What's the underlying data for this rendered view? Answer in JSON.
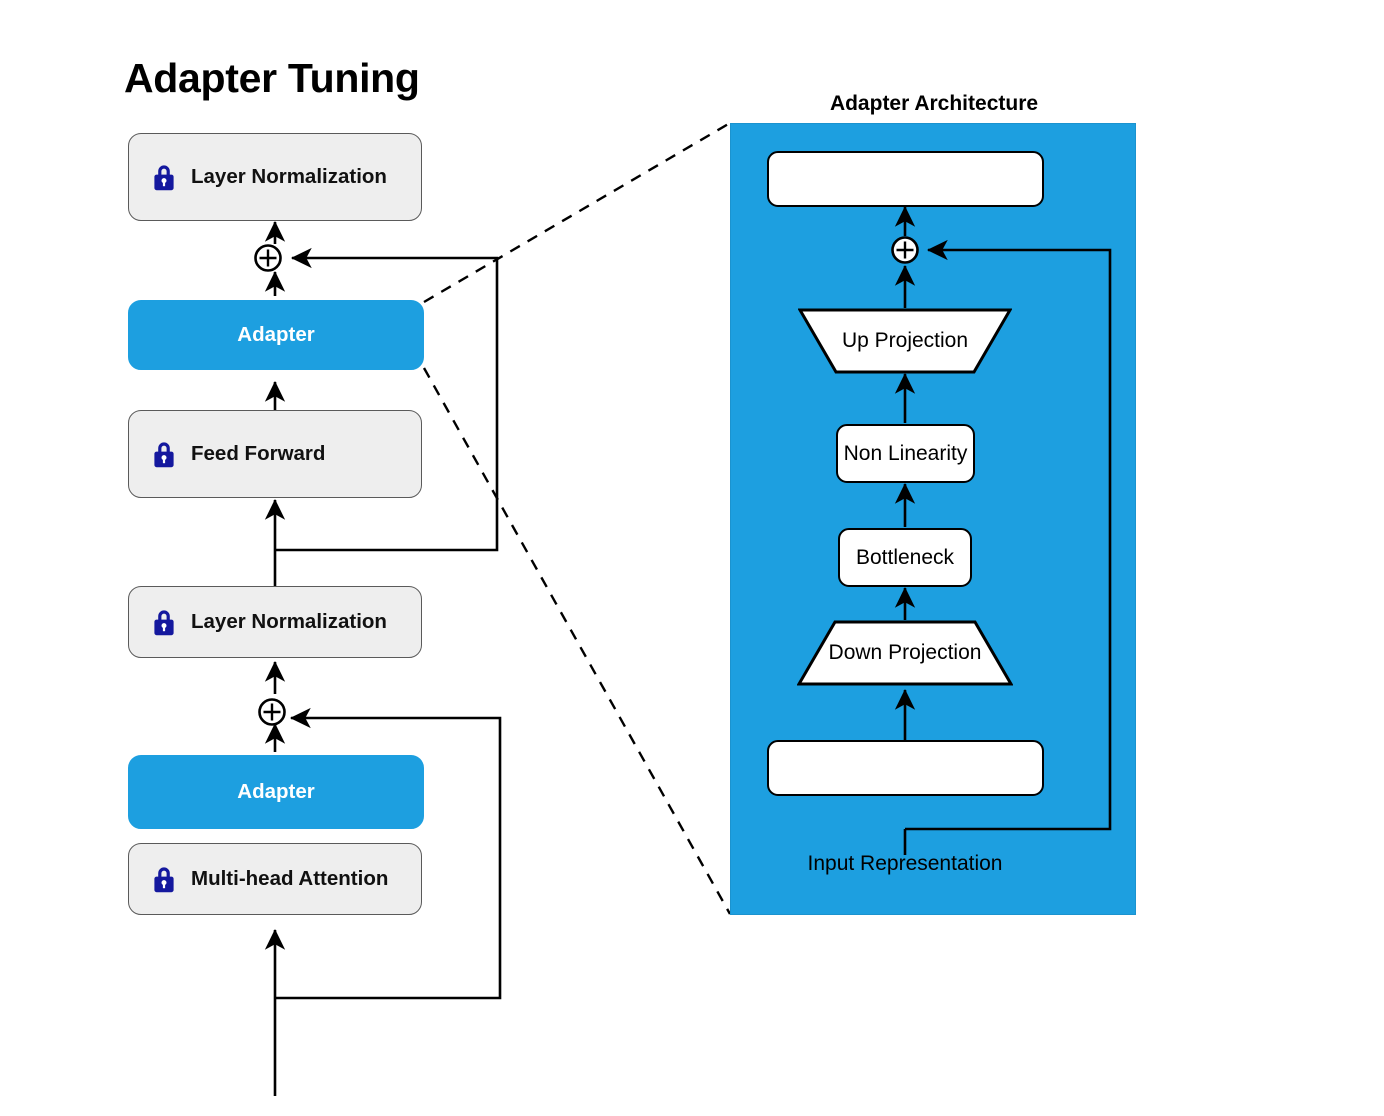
{
  "page": {
    "title": "Adapter Tuning",
    "background": "#ffffff"
  },
  "colors": {
    "adapter_blue": "#1d9fe0",
    "frozen_gray": "#eeeeee",
    "frozen_border": "#5a5a5a",
    "lock_navy": "#14189e",
    "line_black": "#000000"
  },
  "left_diagram": {
    "name": "transformer-block-with-adapters",
    "blocks": [
      {
        "id": "layer-norm-top",
        "label": "Layer Normalization",
        "type": "frozen",
        "icon": "lock-icon"
      },
      {
        "id": "adapter-top",
        "label": "Adapter",
        "type": "adapter",
        "icon": null
      },
      {
        "id": "feed-forward",
        "label": "Feed Forward",
        "type": "frozen",
        "icon": "lock-icon"
      },
      {
        "id": "layer-norm-bottom",
        "label": "Layer Normalization",
        "type": "frozen",
        "icon": "lock-icon"
      },
      {
        "id": "adapter-bottom",
        "label": "Adapter",
        "type": "adapter",
        "icon": null
      },
      {
        "id": "multi-head-attention",
        "label": "Multi-head Attention",
        "type": "frozen",
        "icon": "lock-icon"
      }
    ],
    "operators": [
      {
        "id": "add-top",
        "symbol": "⊕",
        "name": "residual-add-top"
      },
      {
        "id": "add-bottom",
        "symbol": "⊕",
        "name": "residual-add-bottom"
      }
    ]
  },
  "right_panel": {
    "title": "Adapter Architecture",
    "blocks": [
      {
        "id": "output-box",
        "label": "",
        "shape": "rounded-rect"
      },
      {
        "id": "up-projection",
        "label": "Up Projection",
        "shape": "trapezoid-inverted"
      },
      {
        "id": "non-linearity",
        "label": "Non Linearity",
        "shape": "rounded-rect"
      },
      {
        "id": "bottleneck",
        "label": "Bottleneck",
        "shape": "rounded-rect"
      },
      {
        "id": "down-projection",
        "label": "Down Projection",
        "shape": "trapezoid"
      },
      {
        "id": "input-box",
        "label": "",
        "shape": "rounded-rect"
      }
    ],
    "operators": [
      {
        "id": "add-adapter",
        "symbol": "⊕",
        "name": "residual-add-adapter"
      }
    ],
    "caption": "Input Representation"
  }
}
